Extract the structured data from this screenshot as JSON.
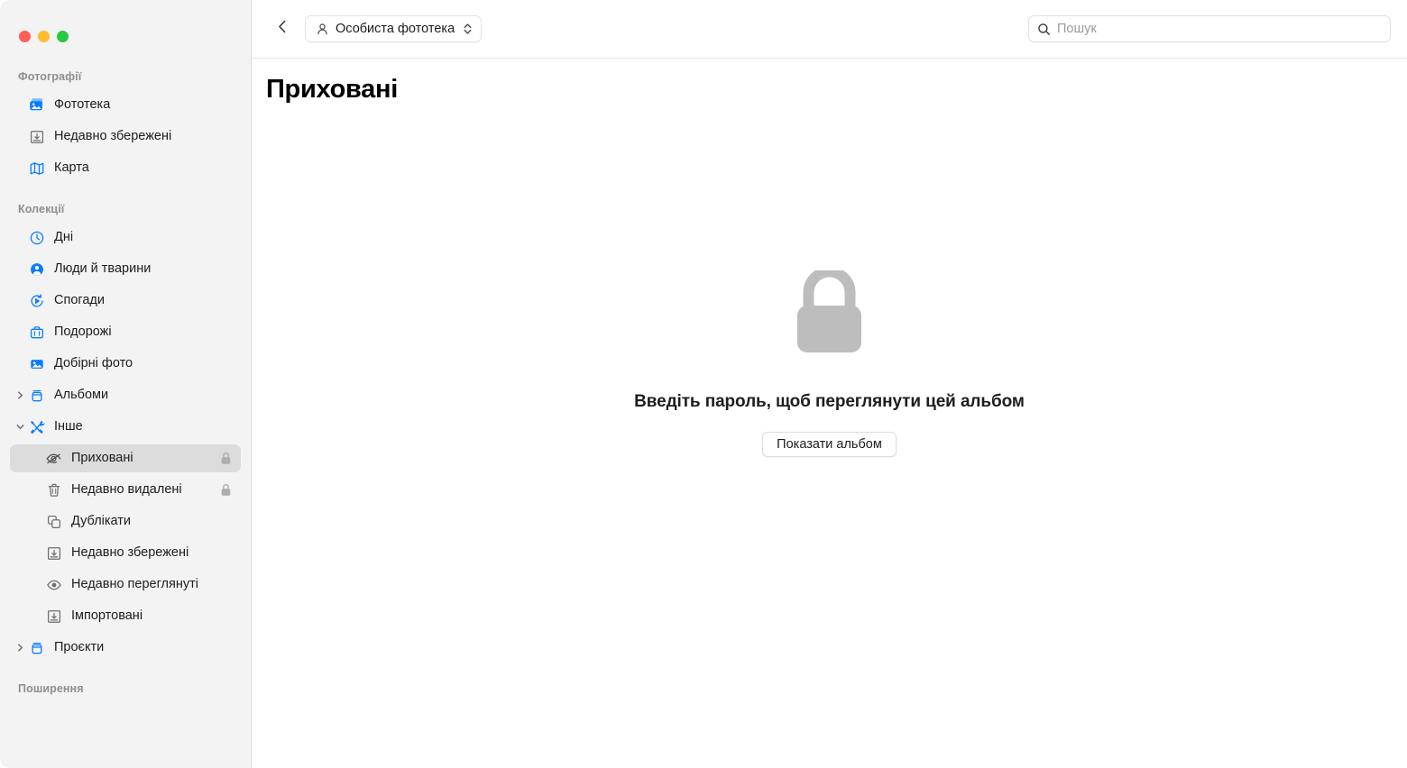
{
  "window": {
    "traffic_lights": {
      "close_color": "#ff5f57",
      "minimize_color": "#febc2e",
      "maximize_color": "#28c840"
    }
  },
  "sidebar": {
    "sections": [
      {
        "header": "Фотографії",
        "items": [
          {
            "label": "Фототека",
            "icon": "photo-library-icon",
            "selected": false
          },
          {
            "label": "Недавно збережені",
            "icon": "download-tray-icon",
            "selected": false
          },
          {
            "label": "Карта",
            "icon": "map-icon",
            "selected": false
          }
        ]
      },
      {
        "header": "Колекції",
        "items": [
          {
            "label": "Дні",
            "icon": "clock-icon",
            "selected": false
          },
          {
            "label": "Люди й тварини",
            "icon": "person-circle-icon",
            "selected": false
          },
          {
            "label": "Спогади",
            "icon": "memories-play-icon",
            "selected": false
          },
          {
            "label": "Подорожі",
            "icon": "suitcase-icon",
            "selected": false
          },
          {
            "label": "Добірні фото",
            "icon": "featured-photo-icon",
            "selected": false
          },
          {
            "label": "Альбоми",
            "icon": "albums-icon",
            "selected": false,
            "disclosure": "collapsed"
          },
          {
            "label": "Інше",
            "icon": "tools-icon",
            "selected": false,
            "disclosure": "expanded"
          },
          {
            "label": "Приховані",
            "icon": "eye-slash-icon",
            "selected": true,
            "child": true,
            "locked": true
          },
          {
            "label": "Недавно видалені",
            "icon": "trash-icon",
            "selected": false,
            "child": true,
            "locked": true
          },
          {
            "label": "Дублікати",
            "icon": "duplicates-icon",
            "selected": false,
            "child": true
          },
          {
            "label": "Недавно збережені",
            "icon": "download-tray-icon",
            "selected": false,
            "child": true
          },
          {
            "label": "Недавно переглянуті",
            "icon": "eye-icon",
            "selected": false,
            "child": true
          },
          {
            "label": "Імпортовані",
            "icon": "download-tray-icon",
            "selected": false,
            "child": true
          },
          {
            "label": "Проєкти",
            "icon": "albums-icon",
            "selected": false,
            "disclosure": "collapsed"
          }
        ]
      },
      {
        "header": "Поширення",
        "items": []
      }
    ]
  },
  "toolbar": {
    "back_icon": "chevron-left-icon",
    "library_popup": {
      "label": "Особиста фототека",
      "leading_icon": "person-icon",
      "trailing_icon": "chevron-up-down-icon"
    },
    "search": {
      "placeholder": "Пошук",
      "icon": "search-icon"
    }
  },
  "main": {
    "title": "Приховані",
    "empty_state": {
      "icon": "lock-icon",
      "message": "Введіть пароль, щоб переглянути цей альбом",
      "button_label": "Показати альбом"
    }
  }
}
